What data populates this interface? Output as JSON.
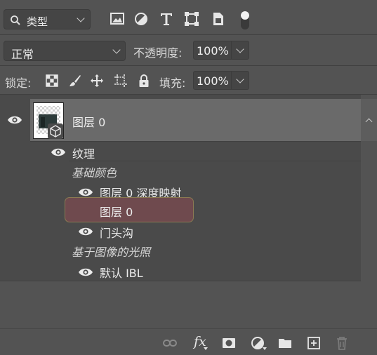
{
  "filter": {
    "kind_label": "类型"
  },
  "blend": {
    "mode_label": "正常",
    "opacity_label": "不透明度:",
    "opacity_value": "100%"
  },
  "lock": {
    "lock_label": "锁定:",
    "fill_label": "填充:",
    "fill_value": "100%"
  },
  "layers": [
    {
      "name": "图层 0"
    }
  ],
  "effects": {
    "texture": "纹理",
    "base_color": "基础颜色",
    "depth_map": "图层 0 深度映射",
    "layer0": "图层 0",
    "door_groove": "门头沟",
    "ibl": "基于图像的光照",
    "default_ibl": "默认 IBL"
  },
  "footer": {
    "fx": "fx"
  }
}
